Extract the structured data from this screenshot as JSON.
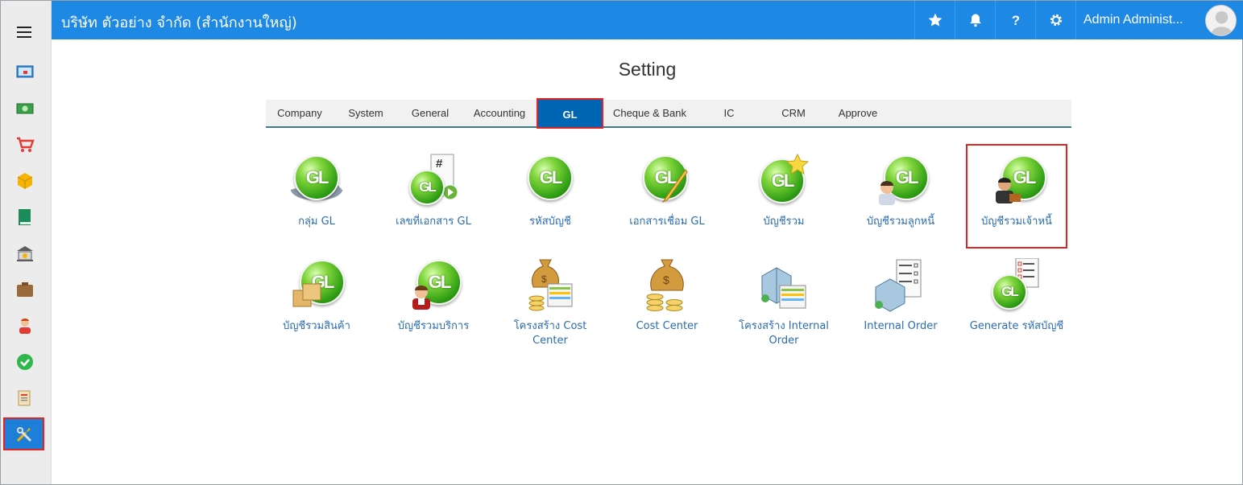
{
  "header": {
    "company": "บริษัท ตัวอย่าง จำกัด (สำนักงานใหญ่)",
    "user": "Admin Administ...",
    "icons": [
      "star-icon",
      "bell-icon",
      "help-icon",
      "gear-icon"
    ]
  },
  "sidebar": {
    "items": [
      "dashboard-icon",
      "money-icon",
      "cart-icon",
      "box-icon",
      "book-icon",
      "bank-icon",
      "wallet-icon",
      "people-icon",
      "check-icon",
      "report-icon",
      "settings-tools-icon"
    ]
  },
  "page": {
    "title": "Setting"
  },
  "tabs": [
    {
      "label": "Company"
    },
    {
      "label": "System"
    },
    {
      "label": "General"
    },
    {
      "label": "Accounting"
    },
    {
      "label": "GL"
    },
    {
      "label": "Cheque & Bank"
    },
    {
      "label": "IC"
    },
    {
      "label": "CRM"
    },
    {
      "label": "Approve"
    }
  ],
  "tiles": [
    {
      "label": "กลุ่ม GL"
    },
    {
      "label": "เลขที่เอกสาร GL"
    },
    {
      "label": "รหัสบัญชี"
    },
    {
      "label": "เอกสารเชื่อม GL"
    },
    {
      "label": "บัญชีรวม"
    },
    {
      "label": "บัญชีรวมลูกหนี้"
    },
    {
      "label": "บัญชีรวมเจ้าหนี้"
    },
    {
      "label": "บัญชีรวมสินค้า"
    },
    {
      "label": "บัญชีรวมบริการ"
    },
    {
      "label": "โครงสร้าง Cost Center"
    },
    {
      "label": "Cost Center"
    },
    {
      "label": "โครงสร้าง Internal Order"
    },
    {
      "label": "Internal Order"
    },
    {
      "label": "Generate รหัสบัญชี"
    }
  ],
  "colors": {
    "topbar": "#1e88e5",
    "active_tab": "#0066b3",
    "highlight": "#e02424",
    "link": "#2a6cb0"
  }
}
